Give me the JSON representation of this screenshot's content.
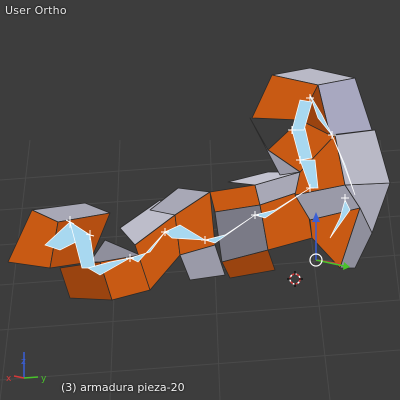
{
  "viewport": {
    "view_label": "User Ortho",
    "object_label": "(3) armadura pieza-20"
  },
  "colors": {
    "background": "#3d3d3d",
    "grid": "#4a4a4a",
    "face_orange": "#c85a14",
    "face_orange_dark": "#9a4410",
    "face_gray": "#9a9aa8",
    "face_gray_light": "#b9b9c6",
    "face_gray_dark": "#6f6f7a",
    "bone": "#a8d8f0",
    "axis_x": "#d63a3a",
    "axis_y": "#49c22c",
    "axis_z": "#3a5fd6"
  },
  "axis_gizmo": {
    "x_label": "x",
    "y_label": "y",
    "z_label": "z"
  }
}
